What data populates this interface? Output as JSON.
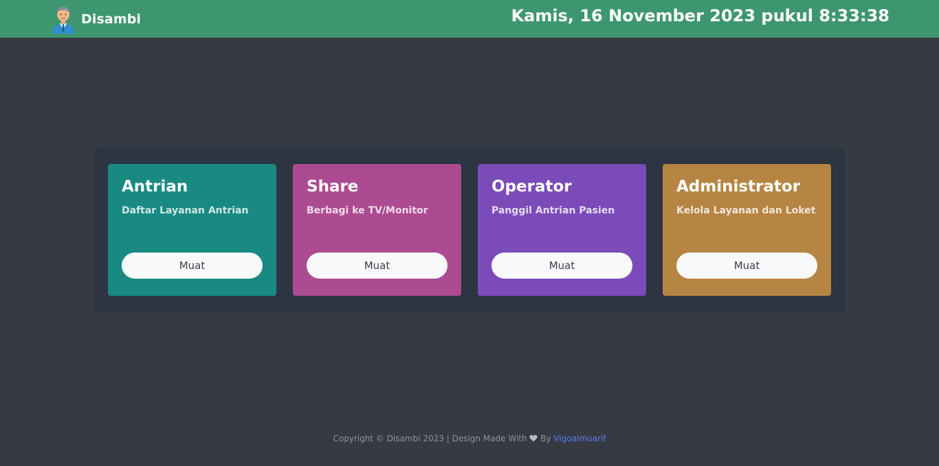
{
  "header": {
    "brand_name": "Disambi",
    "brand_icon": "businessman-avatar-icon",
    "datetime": "Kamis, 16 November 2023 pukul 8:33:38",
    "background_color": "#3e9670"
  },
  "cards": [
    {
      "title": "Antrian",
      "subtitle": "Daftar Layanan Antrian",
      "button_label": "Muat",
      "color": "#188a82"
    },
    {
      "title": "Share",
      "subtitle": "Berbagi ke TV/Monitor",
      "button_label": "Muat",
      "color": "#ad4b92"
    },
    {
      "title": "Operator",
      "subtitle": "Panggil Antrian Pasien",
      "button_label": "Muat",
      "color": "#7b4bb9"
    },
    {
      "title": "Administrator",
      "subtitle": "Kelola Layanan dan Loket",
      "button_label": "Muat",
      "color": "#b78543"
    }
  ],
  "footer": {
    "prefix": "Copyright © Disambi 2023 | Design Made With",
    "heart_icon": "heart-icon",
    "by": "By",
    "author": "Vigoalmuarif",
    "author_color": "#5b7cf0"
  },
  "colors": {
    "page_background": "#363a43",
    "panel_background": "#2c3541"
  }
}
